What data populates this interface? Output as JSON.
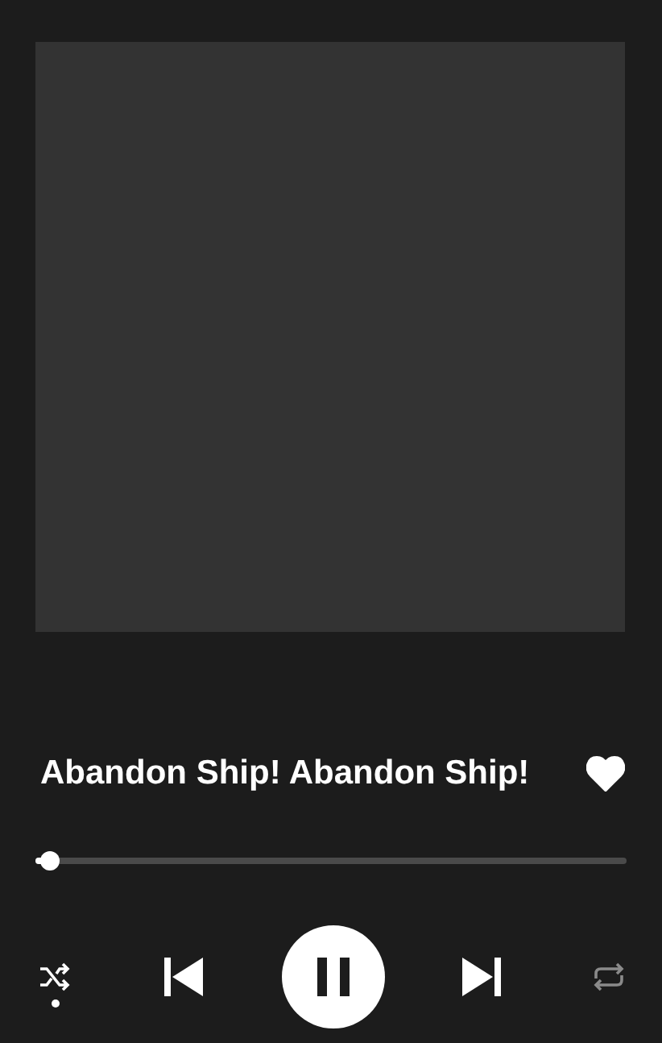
{
  "track": {
    "title": "Abandon Ship! Abandon Ship!",
    "liked": true
  },
  "progress": {
    "level": 0.02
  },
  "controls": {
    "shuffle": true,
    "playing": true,
    "repeat": false
  }
}
